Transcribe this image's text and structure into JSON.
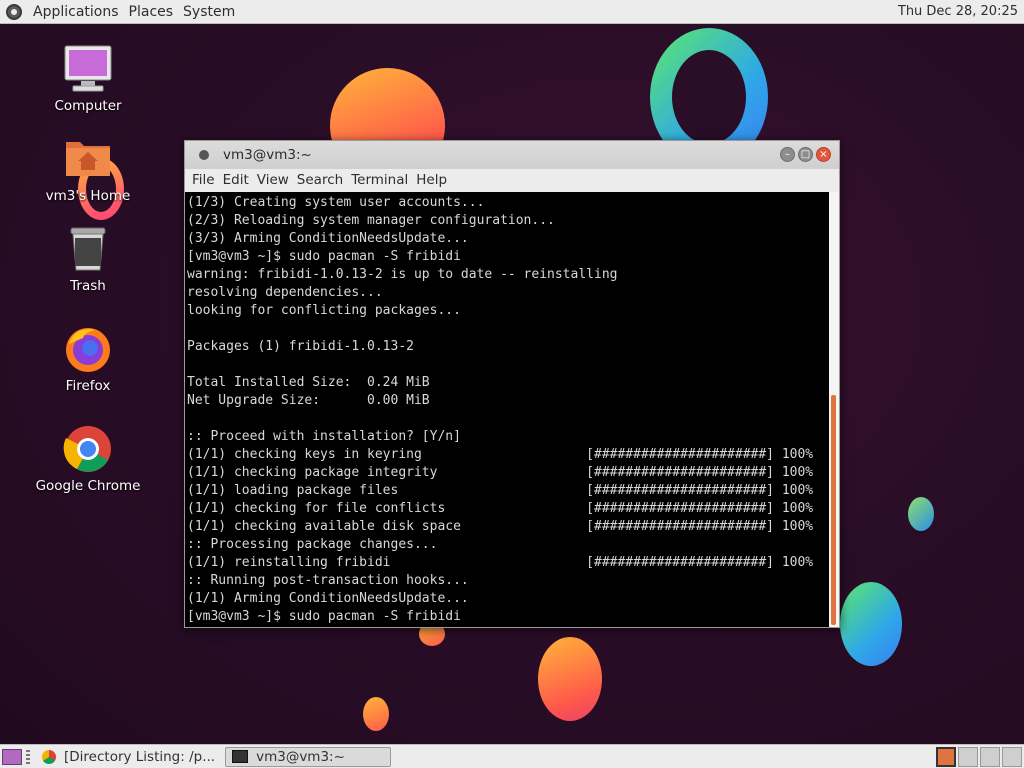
{
  "top_panel": {
    "menus": [
      "Applications",
      "Places",
      "System"
    ],
    "clock": "Thu Dec 28, 20:25"
  },
  "desktop": {
    "icons": [
      {
        "label": "Computer",
        "icon": "computer-icon"
      },
      {
        "label": "vm3's Home",
        "icon": "home-folder-icon"
      },
      {
        "label": "Trash",
        "icon": "trash-icon"
      },
      {
        "label": "Firefox",
        "icon": "firefox-icon"
      },
      {
        "label": "Google Chrome",
        "icon": "chrome-icon"
      }
    ]
  },
  "terminal": {
    "title": "vm3@vm3:~",
    "menus": [
      "File",
      "Edit",
      "View",
      "Search",
      "Terminal",
      "Help"
    ],
    "lines": [
      "(1/3) Creating system user accounts...",
      "(2/3) Reloading system manager configuration...",
      "(3/3) Arming ConditionNeedsUpdate...",
      "[vm3@vm3 ~]$ sudo pacman -S fribidi",
      "warning: fribidi-1.0.13-2 is up to date -- reinstalling",
      "resolving dependencies...",
      "looking for conflicting packages...",
      "",
      "Packages (1) fribidi-1.0.13-2",
      "",
      "Total Installed Size:  0.24 MiB",
      "Net Upgrade Size:      0.00 MiB",
      "",
      ":: Proceed with installation? [Y/n]",
      "(1/1) checking keys in keyring                     [######################] 100%",
      "(1/1) checking package integrity                   [######################] 100%",
      "(1/1) loading package files                        [######################] 100%",
      "(1/1) checking for file conflicts                  [######################] 100%",
      "(1/1) checking available disk space                [######################] 100%",
      ":: Processing package changes...",
      "(1/1) reinstalling fribidi                         [######################] 100%",
      ":: Running post-transaction hooks...",
      "(1/1) Arming ConditionNeedsUpdate...",
      "[vm3@vm3 ~]$ sudo pacman -S fribidi"
    ]
  },
  "bottom_panel": {
    "tasks": [
      {
        "label": "[Directory Listing: /p...",
        "icon": "chrome-icon",
        "active": false
      },
      {
        "label": "vm3@vm3:~",
        "icon": "terminal-icon",
        "active": true
      }
    ]
  },
  "colors": {
    "desktop_bg": "#2a0d27",
    "scroll_thumb": "#e0733e",
    "close_button": "#e0573b"
  }
}
